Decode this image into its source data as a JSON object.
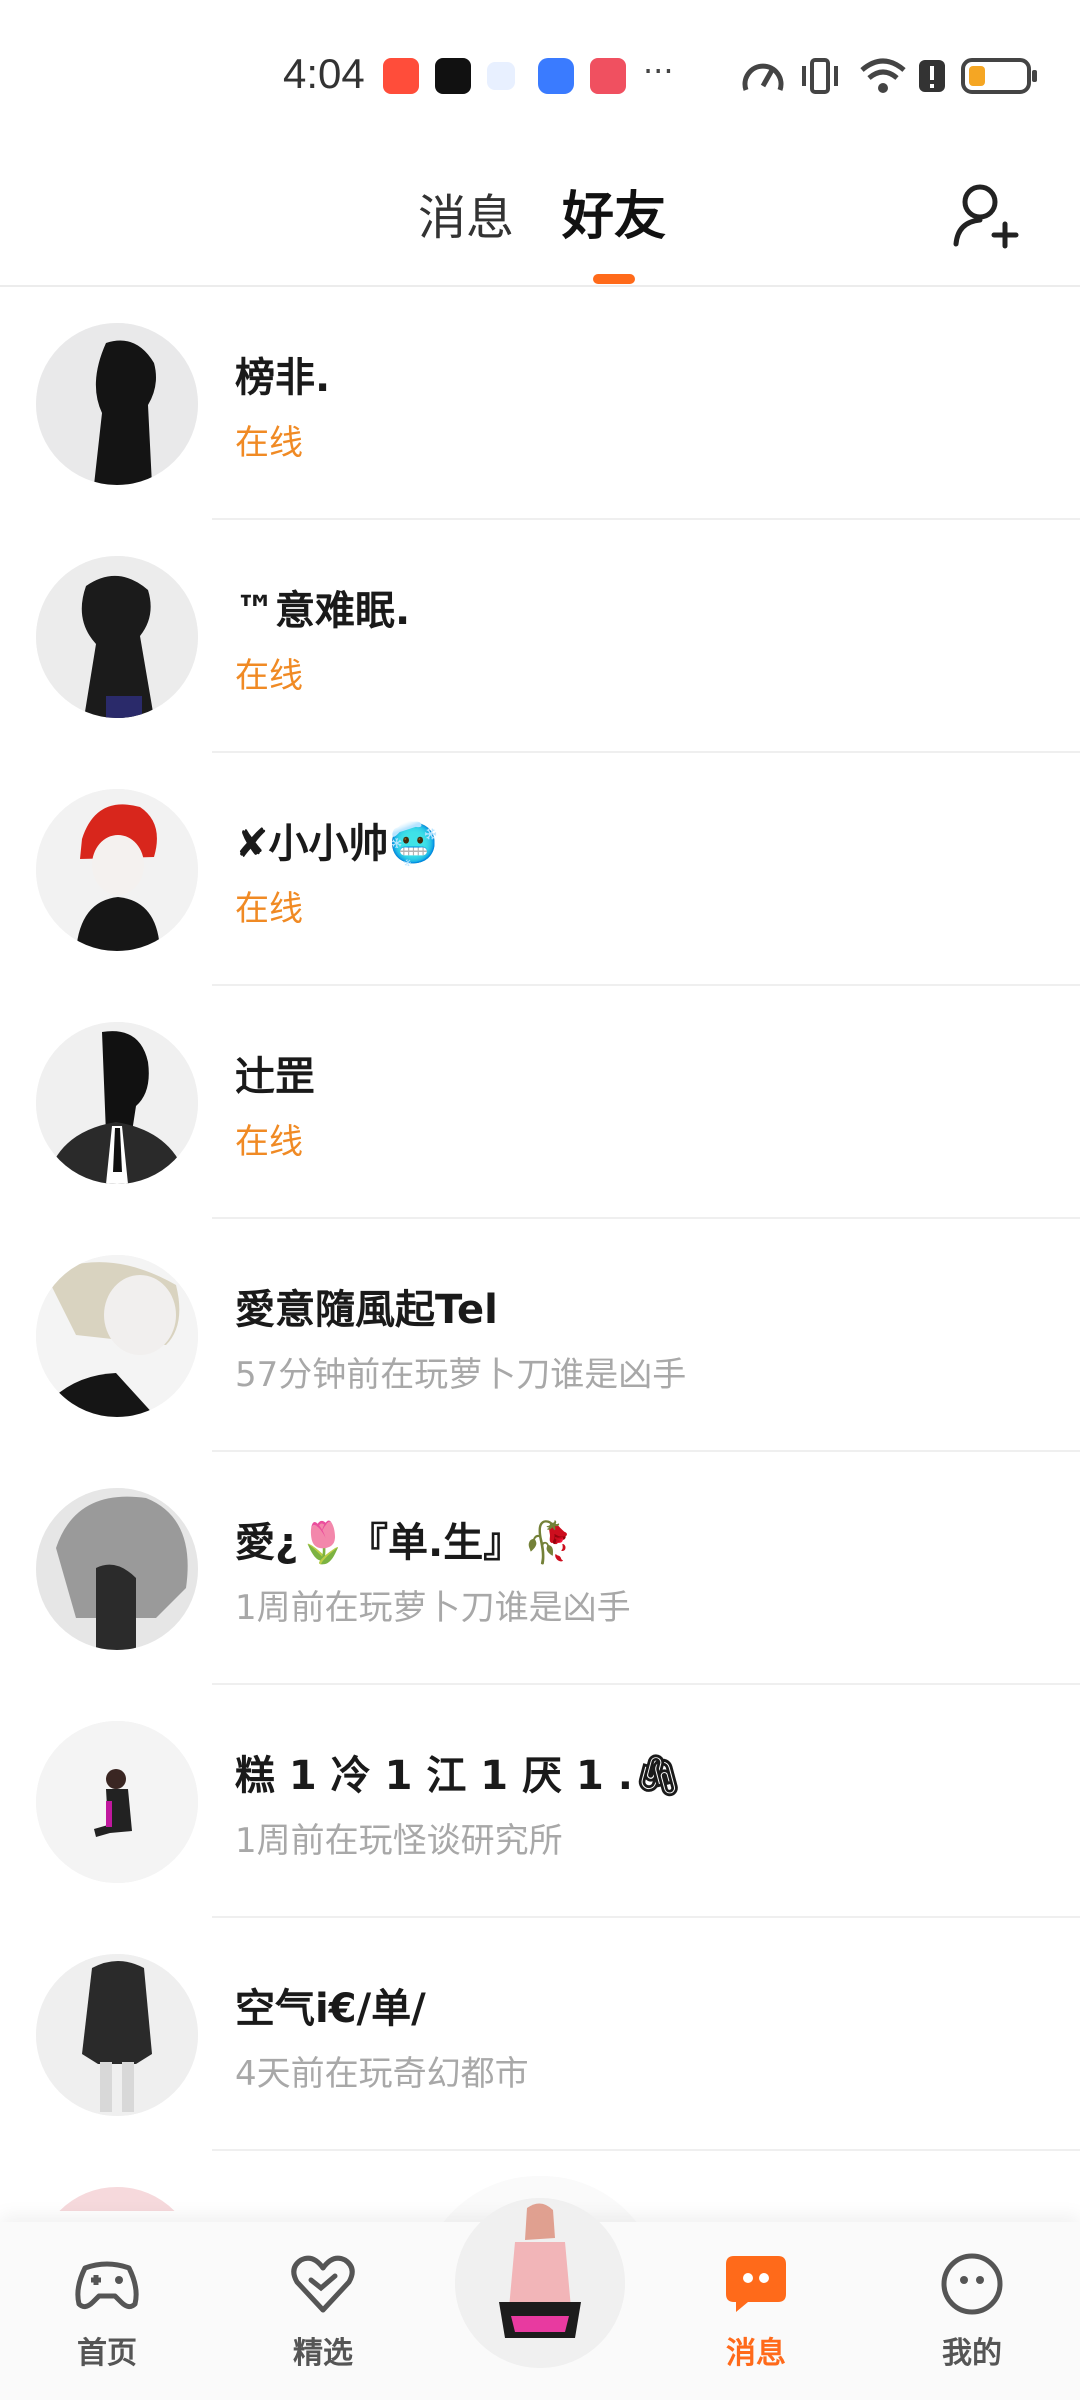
{
  "status_bar": {
    "time": "4:04",
    "more": "···"
  },
  "header": {
    "tabs": [
      {
        "label": "消息",
        "active": false
      },
      {
        "label": "好友",
        "active": true
      }
    ],
    "accent": "#ff6a1a"
  },
  "friends": [
    {
      "name": "榜非.",
      "status": "在线",
      "online": true
    },
    {
      "name": "™意难眠.",
      "status": "在线",
      "online": true
    },
    {
      "name": "✘小小帅🥶",
      "status": "在线",
      "online": true
    },
    {
      "name": "辻罡",
      "status": "在线",
      "online": true
    },
    {
      "name": "愛意隨風起Tel",
      "status": "57分钟前在玩萝卜刀谁是凶手",
      "online": false
    },
    {
      "name": "愛¿🌷『单.生』🥀",
      "status": "1周前在玩萝卜刀谁是凶手",
      "online": false
    },
    {
      "name": "糕 1 冷 1 江 1 厌 1 .🖇",
      "status": "1周前在玩怪谈研究所",
      "online": false
    },
    {
      "name": "空气i€/单/",
      "status": "4天前在玩奇幻都市",
      "online": false
    }
  ],
  "bottom_nav": {
    "items": [
      {
        "label": "首页",
        "icon": "gamepad-icon"
      },
      {
        "label": "精选",
        "icon": "heart-check-icon"
      },
      {
        "label": "消息",
        "icon": "chat-bubble-icon",
        "active": true
      },
      {
        "label": "我的",
        "icon": "smiley-face-icon"
      }
    ]
  }
}
